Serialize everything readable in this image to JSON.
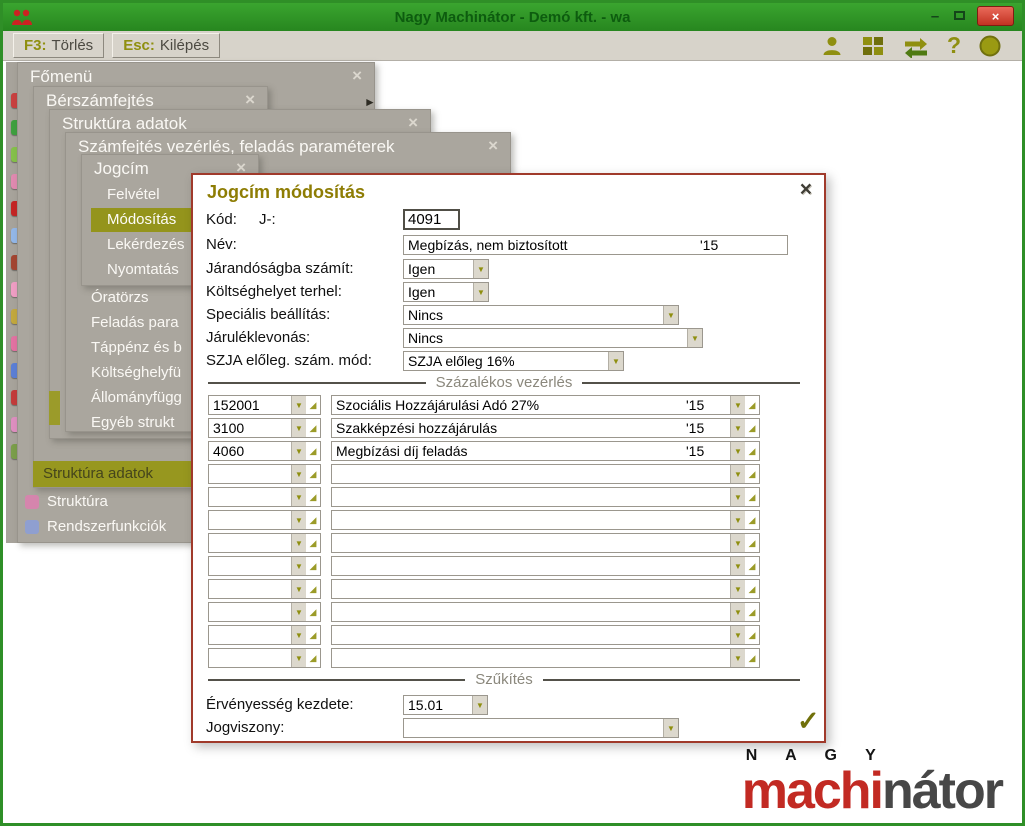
{
  "window": {
    "title": "Nagy Machinátor - Demó kft. - wa"
  },
  "icons": {
    "close": "×",
    "minimize": "–",
    "dropdown_arrow": "▼",
    "grip": "◢",
    "submenu_arrow": "►",
    "confirm": "✓",
    "help": "?"
  },
  "toolbar": {
    "f3_key": "F3:",
    "f3_label": "Törlés",
    "esc_key": "Esc:",
    "esc_label": "Kilépés"
  },
  "menus": {
    "stack": [
      {
        "title": "Főmenü"
      },
      {
        "title": "Bérszámfejtés"
      },
      {
        "title": "Struktúra adatok"
      },
      {
        "title": "Számfejtés vezérlés, feladás paraméterek"
      },
      {
        "title": "Jogcím"
      }
    ],
    "jogcim_items": [
      {
        "label": "Felvétel",
        "selected": false
      },
      {
        "label": "Módosítás",
        "selected": true
      },
      {
        "label": "Lekérdezés",
        "selected": false
      },
      {
        "label": "Nyomtatás",
        "selected": false
      }
    ],
    "struktura_items": [
      "Óratörzs",
      "Feladás para",
      "Táppénz és b",
      "Költséghelyfü",
      "Állományfügg",
      "Egyéb strukt"
    ],
    "bottom_items": [
      {
        "label": "Struktúra adatok",
        "selected": true
      },
      {
        "label": "Struktúra",
        "selected": false,
        "icon_color": "#d585ad"
      },
      {
        "label": "Rendszerfunkciók",
        "selected": false,
        "icon_color": "#8f9fd0"
      }
    ]
  },
  "sidebar": {
    "icon_colors": [
      "#c84040",
      "#3fa03f",
      "#85c04a",
      "#e08ab0",
      "#c42525",
      "#93b7e8",
      "#a34531",
      "#ef9ec4",
      "#c2a83e",
      "#e272a2",
      "#5b7fd6",
      "#c33b3b",
      "#de8fc0",
      "#7a9e4a"
    ]
  },
  "dialog": {
    "title": "Jogcím módosítás",
    "kod": {
      "label": "Kód:",
      "sublabel": "J-:",
      "value": "4091"
    },
    "nev": {
      "label": "Név:",
      "value": "Megbízás, nem biztosított",
      "year": "'15"
    },
    "jarandosag": {
      "label": "Járandóságba számít:",
      "value": "Igen"
    },
    "koltseghely": {
      "label": "Költséghelyet terhel:",
      "value": "Igen"
    },
    "specialis": {
      "label": "Speciális beállítás:",
      "value": "Nincs"
    },
    "jarulek": {
      "label": "Járuléklevonás:",
      "value": "Nincs"
    },
    "szja": {
      "label": "SZJA előleg. szám. mód:",
      "value": "SZJA előleg 16%"
    },
    "section_percent": "Százalékos vezérlés",
    "rows": [
      {
        "code": "152001",
        "name": "Szociális Hozzájárulási Adó 27%",
        "year": "'15"
      },
      {
        "code": "3100",
        "name": "Szakképzési hozzájárulás",
        "year": "'15"
      },
      {
        "code": "4060",
        "name": "Megbízási díj feladás",
        "year": "'15"
      },
      {
        "code": "",
        "name": "",
        "year": ""
      },
      {
        "code": "",
        "name": "",
        "year": ""
      },
      {
        "code": "",
        "name": "",
        "year": ""
      },
      {
        "code": "",
        "name": "",
        "year": ""
      },
      {
        "code": "",
        "name": "",
        "year": ""
      },
      {
        "code": "",
        "name": "",
        "year": ""
      },
      {
        "code": "",
        "name": "",
        "year": ""
      },
      {
        "code": "",
        "name": "",
        "year": ""
      },
      {
        "code": "",
        "name": "",
        "year": ""
      }
    ],
    "section_filter": "Szűkítés",
    "ervenyesseg": {
      "label": "Érvényesség kezdete:",
      "value": "15.01"
    },
    "jogviszony": {
      "label": "Jogviszony:",
      "value": ""
    }
  },
  "logo": {
    "top": "N A G Y",
    "red": "machi",
    "dark": "nátor"
  },
  "colors": {
    "titlebar_green": "#2f9326",
    "accent_olive": "#8f8f10",
    "dialog_border": "#a03a2b",
    "menu_gray": "#aaa69e",
    "selection_olive": "#95951b",
    "logo_red": "#c22a23"
  }
}
